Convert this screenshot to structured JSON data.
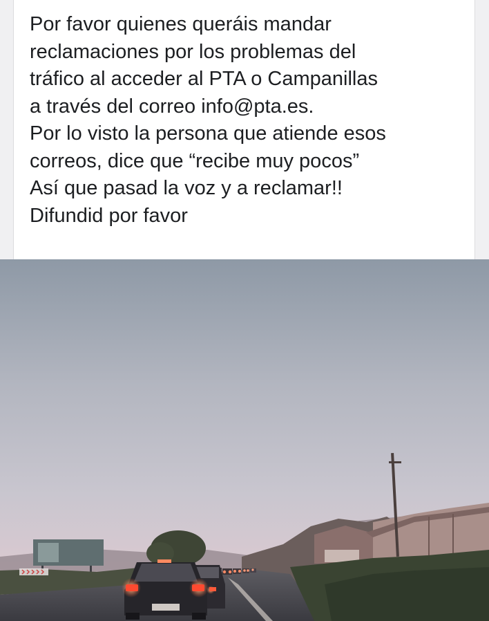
{
  "post": {
    "text_lines": [
      "Por favor quienes queráis mandar",
      "reclamaciones por los problemas del",
      "tráfico al acceder al  PTA o Campanillas",
      "a través del correo info@pta.es.",
      "Por lo visto la persona que atiende esos",
      "correos, dice que “recibe muy pocos”",
      "Así que pasad la voz y a reclamar!!",
      "Difundid por favor"
    ]
  },
  "photo": {
    "subject": "traffic-jam-photo",
    "colors": {
      "sky_top": "#8e99a6",
      "sky_mid": "#c9c6cf",
      "sky_horizon": "#e6ccd1",
      "road": "#4c4c52",
      "vegetation": "#3e4a38",
      "wall": "#a98f8a"
    }
  }
}
